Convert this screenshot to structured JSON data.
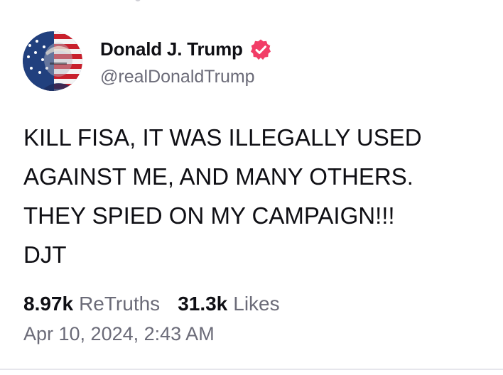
{
  "author": {
    "display_name": "Donald J. Trump",
    "handle": "@realDonaldTrump",
    "verified_icon": "verified-badge-icon",
    "verified_color": "#f23d67"
  },
  "post": {
    "text": "KILL FISA, IT WAS ILLEGALLY USED\nAGAINST ME, AND MANY OTHERS.\nTHEY SPIED ON MY CAMPAIGN!!!\nDJT",
    "retruths_count": "8.97k",
    "retruths_label": "ReTruths",
    "likes_count": "31.3k",
    "likes_label": "Likes",
    "timestamp": "Apr 10, 2024, 2:43 AM"
  },
  "colors": {
    "text_primary": "#0f0f14",
    "text_secondary": "#6b6b78",
    "divider": "#e6e6ec"
  }
}
